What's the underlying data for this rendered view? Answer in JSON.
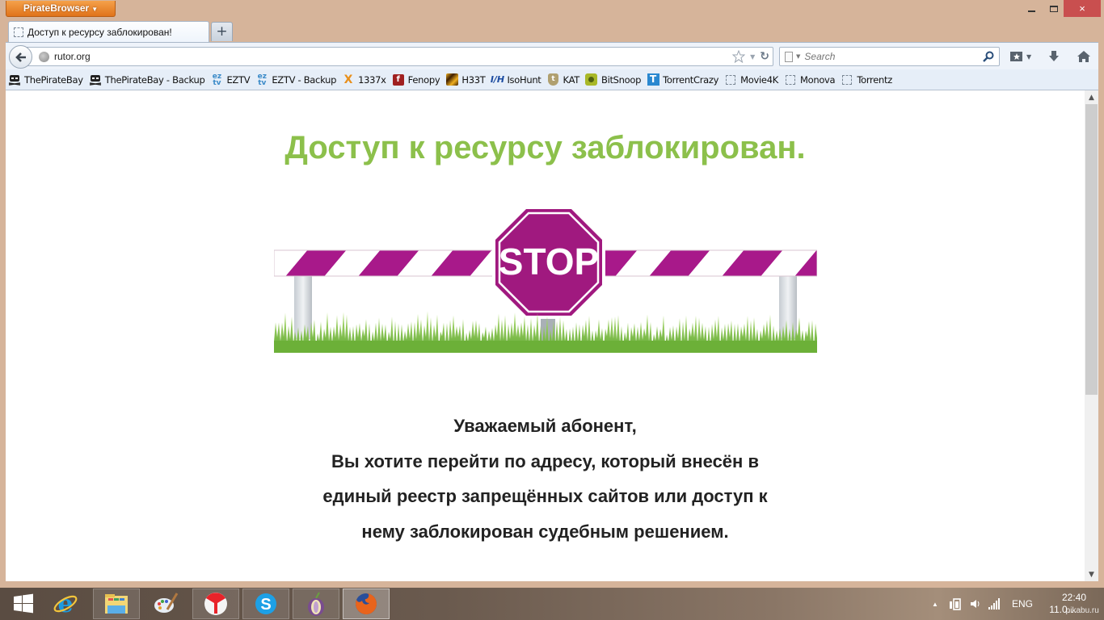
{
  "app": {
    "menu_button_label": "PirateBrowser",
    "window_controls": {
      "minimize": "minimize",
      "maximize": "maximize",
      "close": "×"
    }
  },
  "tabs": [
    {
      "title": "Доступ к ресурсу заблокирован!",
      "active": true,
      "icon": "blank-page-icon"
    }
  ],
  "new_tab_label": "+",
  "navbar": {
    "url": "rutor.org",
    "search_placeholder": "Search",
    "icons": [
      "back-arrow-icon",
      "globe-icon",
      "bookmark-star-icon",
      "history-dropdown-icon",
      "reload-icon",
      "search-engine-icon",
      "magnifier-icon",
      "bookmarks-menu-icon",
      "downloads-icon",
      "home-icon"
    ]
  },
  "bookmarks": [
    {
      "label": "ThePirateBay",
      "icon": "pirate-ship-icon"
    },
    {
      "label": "ThePirateBay - Backup",
      "icon": "pirate-ship-icon"
    },
    {
      "label": "EZTV",
      "icon": "eztv-icon"
    },
    {
      "label": "EZTV - Backup",
      "icon": "eztv-icon"
    },
    {
      "label": "1337x",
      "icon": "1337x-icon"
    },
    {
      "label": "Fenopy",
      "icon": "fenopy-icon"
    },
    {
      "label": "H33T",
      "icon": "h33t-icon"
    },
    {
      "label": "IsoHunt",
      "icon": "isohunt-icon"
    },
    {
      "label": "KAT",
      "icon": "kat-icon"
    },
    {
      "label": "BitSnoop",
      "icon": "bitsnoop-icon"
    },
    {
      "label": "TorrentCrazy",
      "icon": "torrentcrazy-icon"
    },
    {
      "label": "Movie4K",
      "icon": "blank-page-icon"
    },
    {
      "label": "Monova",
      "icon": "blank-page-icon"
    },
    {
      "label": "Torrentz",
      "icon": "blank-page-icon"
    }
  ],
  "page": {
    "headline": "Доступ к ресурсу заблокирован.",
    "sign_text": "STOP",
    "message_lines": [
      "Уважаемый абонент,",
      "Вы хотите перейти по адресу, который внесён в",
      "единый реестр запрещённых сайтов или доступ к",
      "нему заблокирован судебным решением."
    ],
    "colors": {
      "headline": "#8cc04b",
      "sign": "#a0197f",
      "text": "#222222"
    }
  },
  "scrollbar": {
    "position_fraction": 0.0,
    "visible_fraction": 0.62
  },
  "taskbar": {
    "apps": [
      {
        "name": "start",
        "icon": "windows-start-icon"
      },
      {
        "name": "Internet Explorer",
        "icon": "internet-explorer-icon"
      },
      {
        "name": "File Explorer",
        "icon": "file-explorer-icon"
      },
      {
        "name": "Paint",
        "icon": "paint-palette-icon"
      },
      {
        "name": "Yandex Browser",
        "icon": "yandex-browser-icon"
      },
      {
        "name": "Skype",
        "icon": "skype-icon"
      },
      {
        "name": "Tor Browser",
        "icon": "tor-onion-icon"
      },
      {
        "name": "Firefox",
        "icon": "firefox-icon"
      }
    ],
    "tray": {
      "language": "ENG",
      "time": "22:40",
      "date": "11.0…",
      "watermark": "pikabu.ru"
    }
  }
}
